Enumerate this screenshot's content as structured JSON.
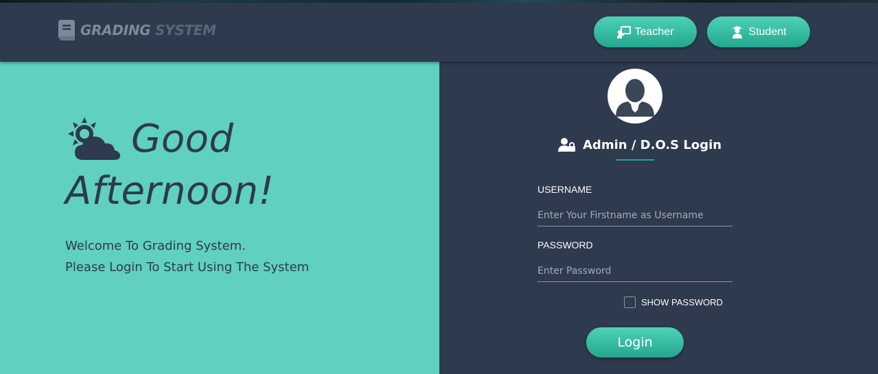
{
  "header": {
    "brand_word1": "GRADING",
    "brand_word2": "SYSTEM",
    "brand_icon": "book-icon",
    "buttons": [
      {
        "label": "Teacher",
        "icon": "chalkboard-teacher-icon"
      },
      {
        "label": "Student",
        "icon": "user-graduate-icon"
      }
    ]
  },
  "hero": {
    "icon": "cloud-sun-icon",
    "greeting_line1": "Good",
    "greeting_line2": "Afternoon!",
    "welcome_line1": "Welcome To Grading System.",
    "welcome_line2": "Please Login To Start Using The System"
  },
  "login": {
    "avatar_icon": "user-avatar-icon",
    "title_icon": "user-lock-icon",
    "title": "Admin / D.O.S Login",
    "username_label": "USERNAME",
    "username_placeholder": "Enter Your Firstname as Username",
    "username_value": "",
    "password_label": "PASSWORD",
    "password_placeholder": "Enter Password",
    "password_value": "",
    "show_password_label": "SHOW PASSWORD",
    "show_password_checked": false,
    "submit_label": "Login"
  },
  "colors": {
    "dark_bg": "#2e3a4e",
    "teal_panel": "#5fd1be",
    "accent": "#22a88e",
    "text_dark": "#2e3a4e"
  }
}
